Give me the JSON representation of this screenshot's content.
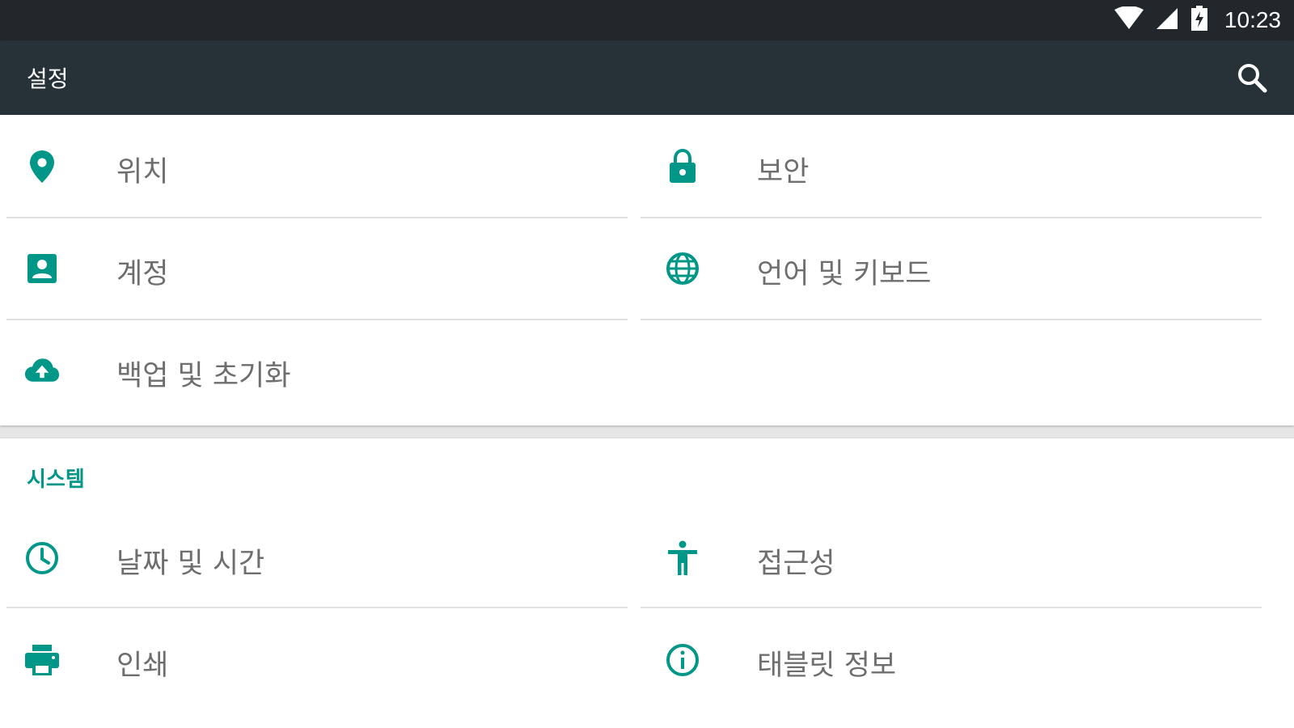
{
  "status_bar": {
    "time": "10:23",
    "icons": [
      "wifi-icon",
      "cell-signal-icon",
      "battery-charging-icon"
    ]
  },
  "toolbar": {
    "title": "설정",
    "search_icon": "search-icon"
  },
  "accent_color": "#009688",
  "personal_section": {
    "items": [
      {
        "label": "위치",
        "icon": "location-pin-icon"
      },
      {
        "label": "보안",
        "icon": "lock-icon"
      },
      {
        "label": "계정",
        "icon": "account-box-icon"
      },
      {
        "label": "언어 및 키보드",
        "icon": "globe-icon"
      },
      {
        "label": "백업 및 초기화",
        "icon": "cloud-upload-icon"
      }
    ]
  },
  "system_section": {
    "header": "시스템",
    "items": [
      {
        "label": "날짜 및 시간",
        "icon": "clock-icon"
      },
      {
        "label": "접근성",
        "icon": "accessibility-icon"
      },
      {
        "label": "인쇄",
        "icon": "printer-icon"
      },
      {
        "label": "태블릿 정보",
        "icon": "info-icon"
      }
    ]
  }
}
